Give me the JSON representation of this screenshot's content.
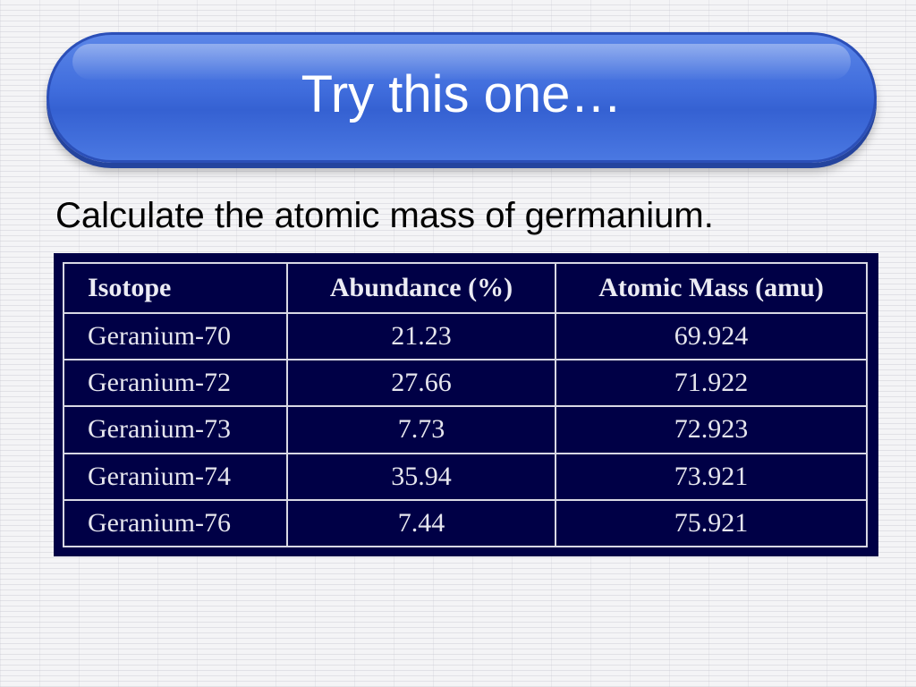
{
  "slide": {
    "title": "Try this one…",
    "prompt": "Calculate the atomic mass of germanium."
  },
  "table": {
    "headers": [
      "Isotope",
      "Abundance (%)",
      "Atomic Mass (amu)"
    ],
    "rows": [
      [
        "Geranium-70",
        "21.23",
        "69.924"
      ],
      [
        "Geranium-72",
        "27.66",
        "71.922"
      ],
      [
        "Geranium-73",
        "7.73",
        "72.923"
      ],
      [
        "Geranium-74",
        "35.94",
        "73.921"
      ],
      [
        "Geranium-76",
        "7.44",
        "75.921"
      ]
    ]
  },
  "colors": {
    "banner": "#3f6cdc",
    "table_background": "#000046",
    "table_text": "#e6e6ee"
  }
}
